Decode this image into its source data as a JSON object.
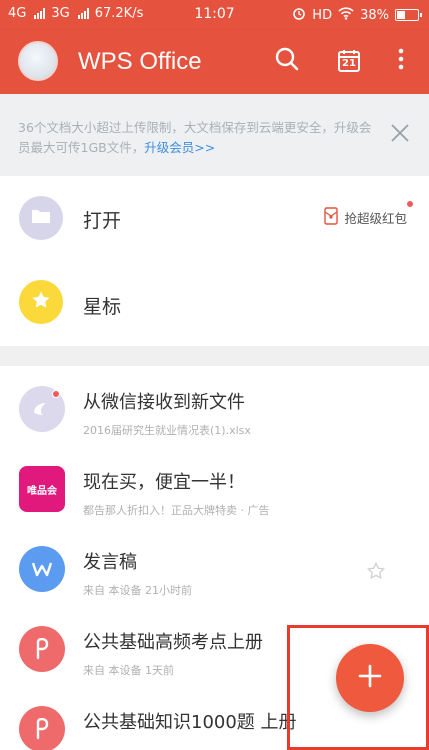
{
  "status_bar": {
    "network1": "4G",
    "network2": "3G",
    "speed": "67.2K/s",
    "time": "11:07",
    "hd": "HD",
    "battery": "38%",
    "battery_level": 0.38
  },
  "app_bar": {
    "title": "WPS Office",
    "calendar_day": "21"
  },
  "banner": {
    "text": "36个文档大小超过上传限制，大文档保存到云端更安全，升级会员最大可传1GB文件，",
    "link": "升级会员>>"
  },
  "quick": {
    "open_label": "打开",
    "star_label": "星标",
    "gift_label": "抢超级红包"
  },
  "recent": [
    {
      "title": "从微信接收到新文件",
      "sub": "2016届研究生就业情况表(1).xlsx",
      "thumb_text": ""
    },
    {
      "title": "现在买，便宜一半！",
      "sub": "都告那人折扣入！正品大牌特卖 · 广告",
      "thumb_text": "唯品会"
    },
    {
      "title": "发言稿",
      "sub": "来自 本设备     21小时前",
      "thumb_text": ""
    },
    {
      "title": "公共基础高频考点上册",
      "sub": "来自 本设备     1天前",
      "thumb_text": ""
    },
    {
      "title": "公共基础知识1000题 上册",
      "sub": "",
      "thumb_text": ""
    }
  ],
  "colors": {
    "brand": "#e5523d",
    "fab": "#ef5a3f",
    "link": "#3f8de0"
  },
  "icons": {
    "search": "search-icon",
    "calendar": "calendar-icon",
    "more": "more-vertical-icon",
    "close": "close-icon",
    "folder": "folder-icon",
    "star": "star-icon",
    "gift": "red-envelope-icon",
    "wechat": "wechat-file-icon",
    "wps_writer": "wps-writer-icon",
    "wps_pdf": "wps-pdf-icon",
    "add": "plus-icon"
  }
}
